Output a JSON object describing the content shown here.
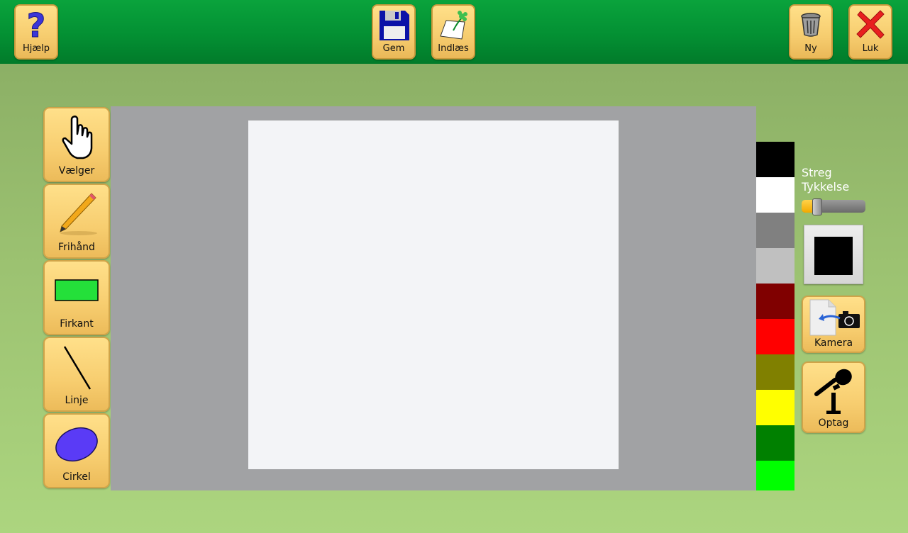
{
  "toolbar": {
    "help_label": "Hjælp",
    "save_label": "Gem",
    "load_label": "Indlæs",
    "new_label": "Ny",
    "close_label": "Luk",
    "icons": {
      "help": "question-mark-icon",
      "save": "floppy-disk-icon",
      "load": "load-picture-icon",
      "new": "trash-can-icon",
      "close": "red-x-icon"
    }
  },
  "tools": [
    {
      "label": "Vælger",
      "icon": "hand-pointer-icon"
    },
    {
      "label": "Frihånd",
      "icon": "pencil-icon"
    },
    {
      "label": "Firkant",
      "icon": "rectangle-icon"
    },
    {
      "label": "Linje",
      "icon": "line-icon"
    },
    {
      "label": "Cirkel",
      "icon": "ellipse-icon"
    }
  ],
  "palette": [
    "#000000",
    "#ffffff",
    "#808080",
    "#c0c0c0",
    "#800000",
    "#ff0000",
    "#808000",
    "#ffff00",
    "#008000",
    "#00ff00"
  ],
  "stroke": {
    "label_line1": "Streg",
    "label_line2": "Tykkelse",
    "thickness_fraction": 0.15
  },
  "current_color": "#000000",
  "right": {
    "camera_label": "Kamera",
    "record_label": "Optag",
    "icons": {
      "camera": "camera-import-icon",
      "record": "microphone-icon"
    }
  },
  "colors": {
    "topbar": "#039033",
    "button": "#f7cd6f",
    "canvas_bg": "#a1a2a4",
    "paper": "#f3f4f7"
  }
}
